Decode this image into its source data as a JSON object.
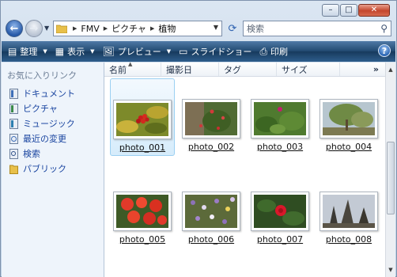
{
  "window": {
    "controls": {
      "minimize": "–",
      "maximize": "□",
      "close": "✕"
    }
  },
  "address": {
    "crumbs": [
      "FMV",
      "ピクチャ",
      "植物"
    ]
  },
  "search": {
    "placeholder": "検索"
  },
  "toolbar": {
    "organize": "整理",
    "view": "表示",
    "preview": "プレビュー",
    "slideshow": "スライドショー",
    "print": "印刷",
    "help": "?"
  },
  "navpane": {
    "title": "お気に入りリンク",
    "items": [
      {
        "label": "ドキュメント",
        "icon": "document-icon"
      },
      {
        "label": "ピクチャ",
        "icon": "pictures-icon"
      },
      {
        "label": "ミュージック",
        "icon": "music-icon"
      },
      {
        "label": "最近の変更",
        "icon": "recent-changes-icon"
      },
      {
        "label": "検索",
        "icon": "search-folder-icon"
      },
      {
        "label": "パブリック",
        "icon": "public-folder-icon"
      }
    ]
  },
  "columns": {
    "name": "名前",
    "date_taken": "撮影日",
    "tags": "タグ",
    "size": "サイズ",
    "more": "»"
  },
  "files": [
    {
      "label": "photo_001",
      "selected": true
    },
    {
      "label": "photo_002",
      "selected": false
    },
    {
      "label": "photo_003",
      "selected": false
    },
    {
      "label": "photo_004",
      "selected": false
    },
    {
      "label": "photo_005",
      "selected": false
    },
    {
      "label": "photo_006",
      "selected": false
    },
    {
      "label": "photo_007",
      "selected": false
    },
    {
      "label": "photo_008",
      "selected": false
    }
  ],
  "colors": {
    "selection_border": "#9bd0f2",
    "link_blue": "#1a45a0",
    "toolbar_dark": "#20486f"
  }
}
